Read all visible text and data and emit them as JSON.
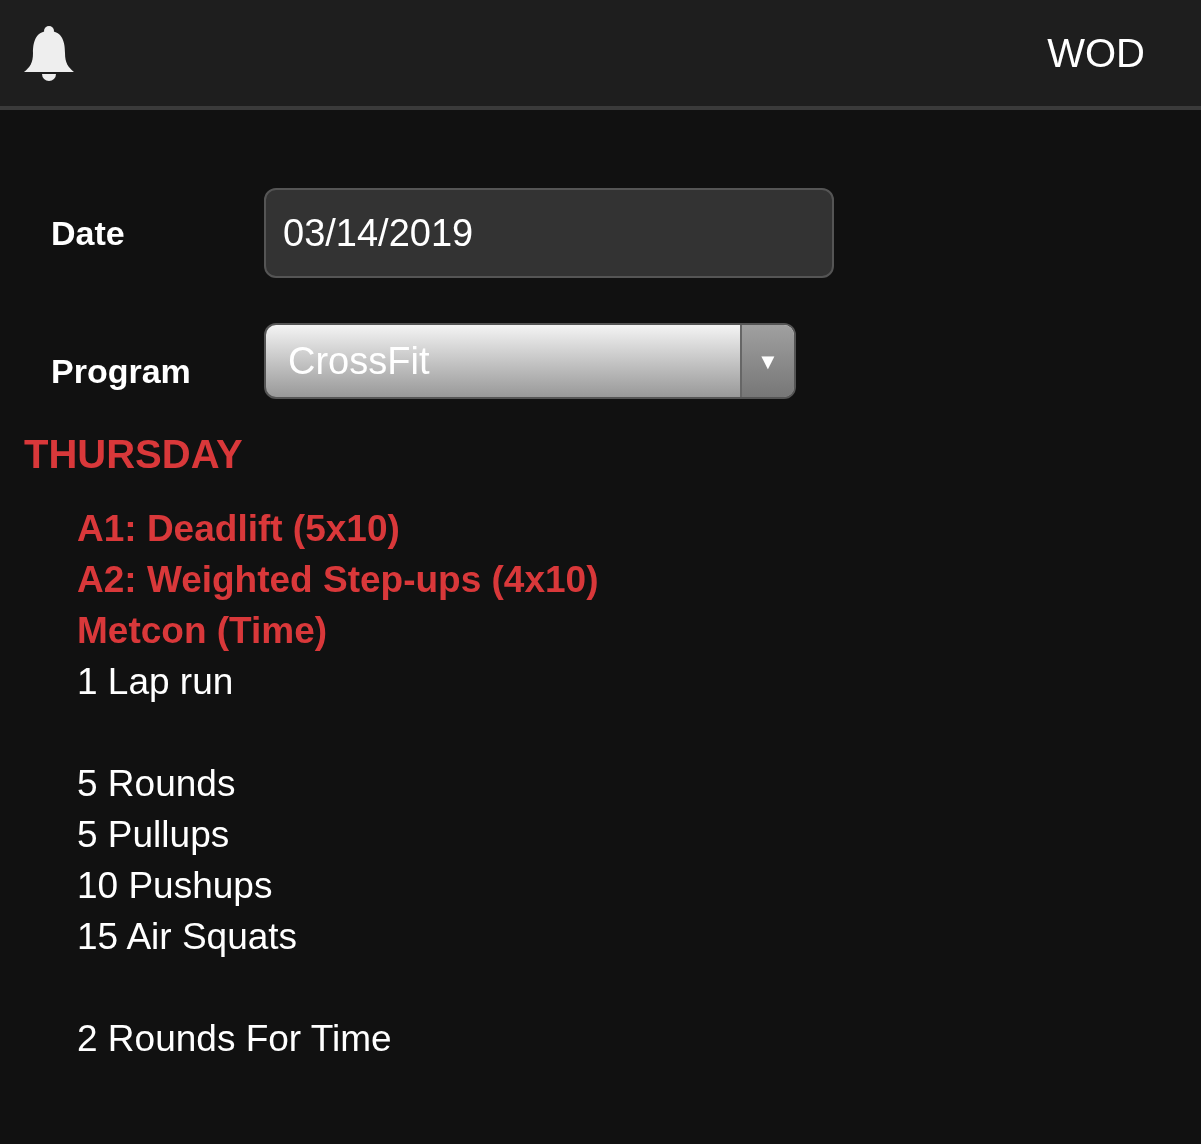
{
  "header": {
    "title": "WOD"
  },
  "form": {
    "date": {
      "label": "Date",
      "value": "03/14/2019"
    },
    "program": {
      "label": "Program",
      "value": "CrossFit",
      "arrow": "▼"
    }
  },
  "day": "THURSDAY",
  "blocks": [
    {
      "lines": [
        {
          "kind": "heading",
          "text": "A1: Deadlift (5x10)"
        },
        {
          "kind": "heading",
          "text": "A2: Weighted Step-ups (4x10)"
        },
        {
          "kind": "heading",
          "text": "Metcon (Time)"
        },
        {
          "kind": "line",
          "text": "1 Lap run"
        }
      ]
    },
    {
      "lines": [
        {
          "kind": "line",
          "text": "5 Rounds"
        },
        {
          "kind": "line",
          "text": "5 Pullups"
        },
        {
          "kind": "line",
          "text": "10 Pushups"
        },
        {
          "kind": "line",
          "text": "15 Air Squats"
        }
      ]
    },
    {
      "lines": [
        {
          "kind": "line",
          "text": "2 Rounds For Time"
        }
      ]
    }
  ]
}
